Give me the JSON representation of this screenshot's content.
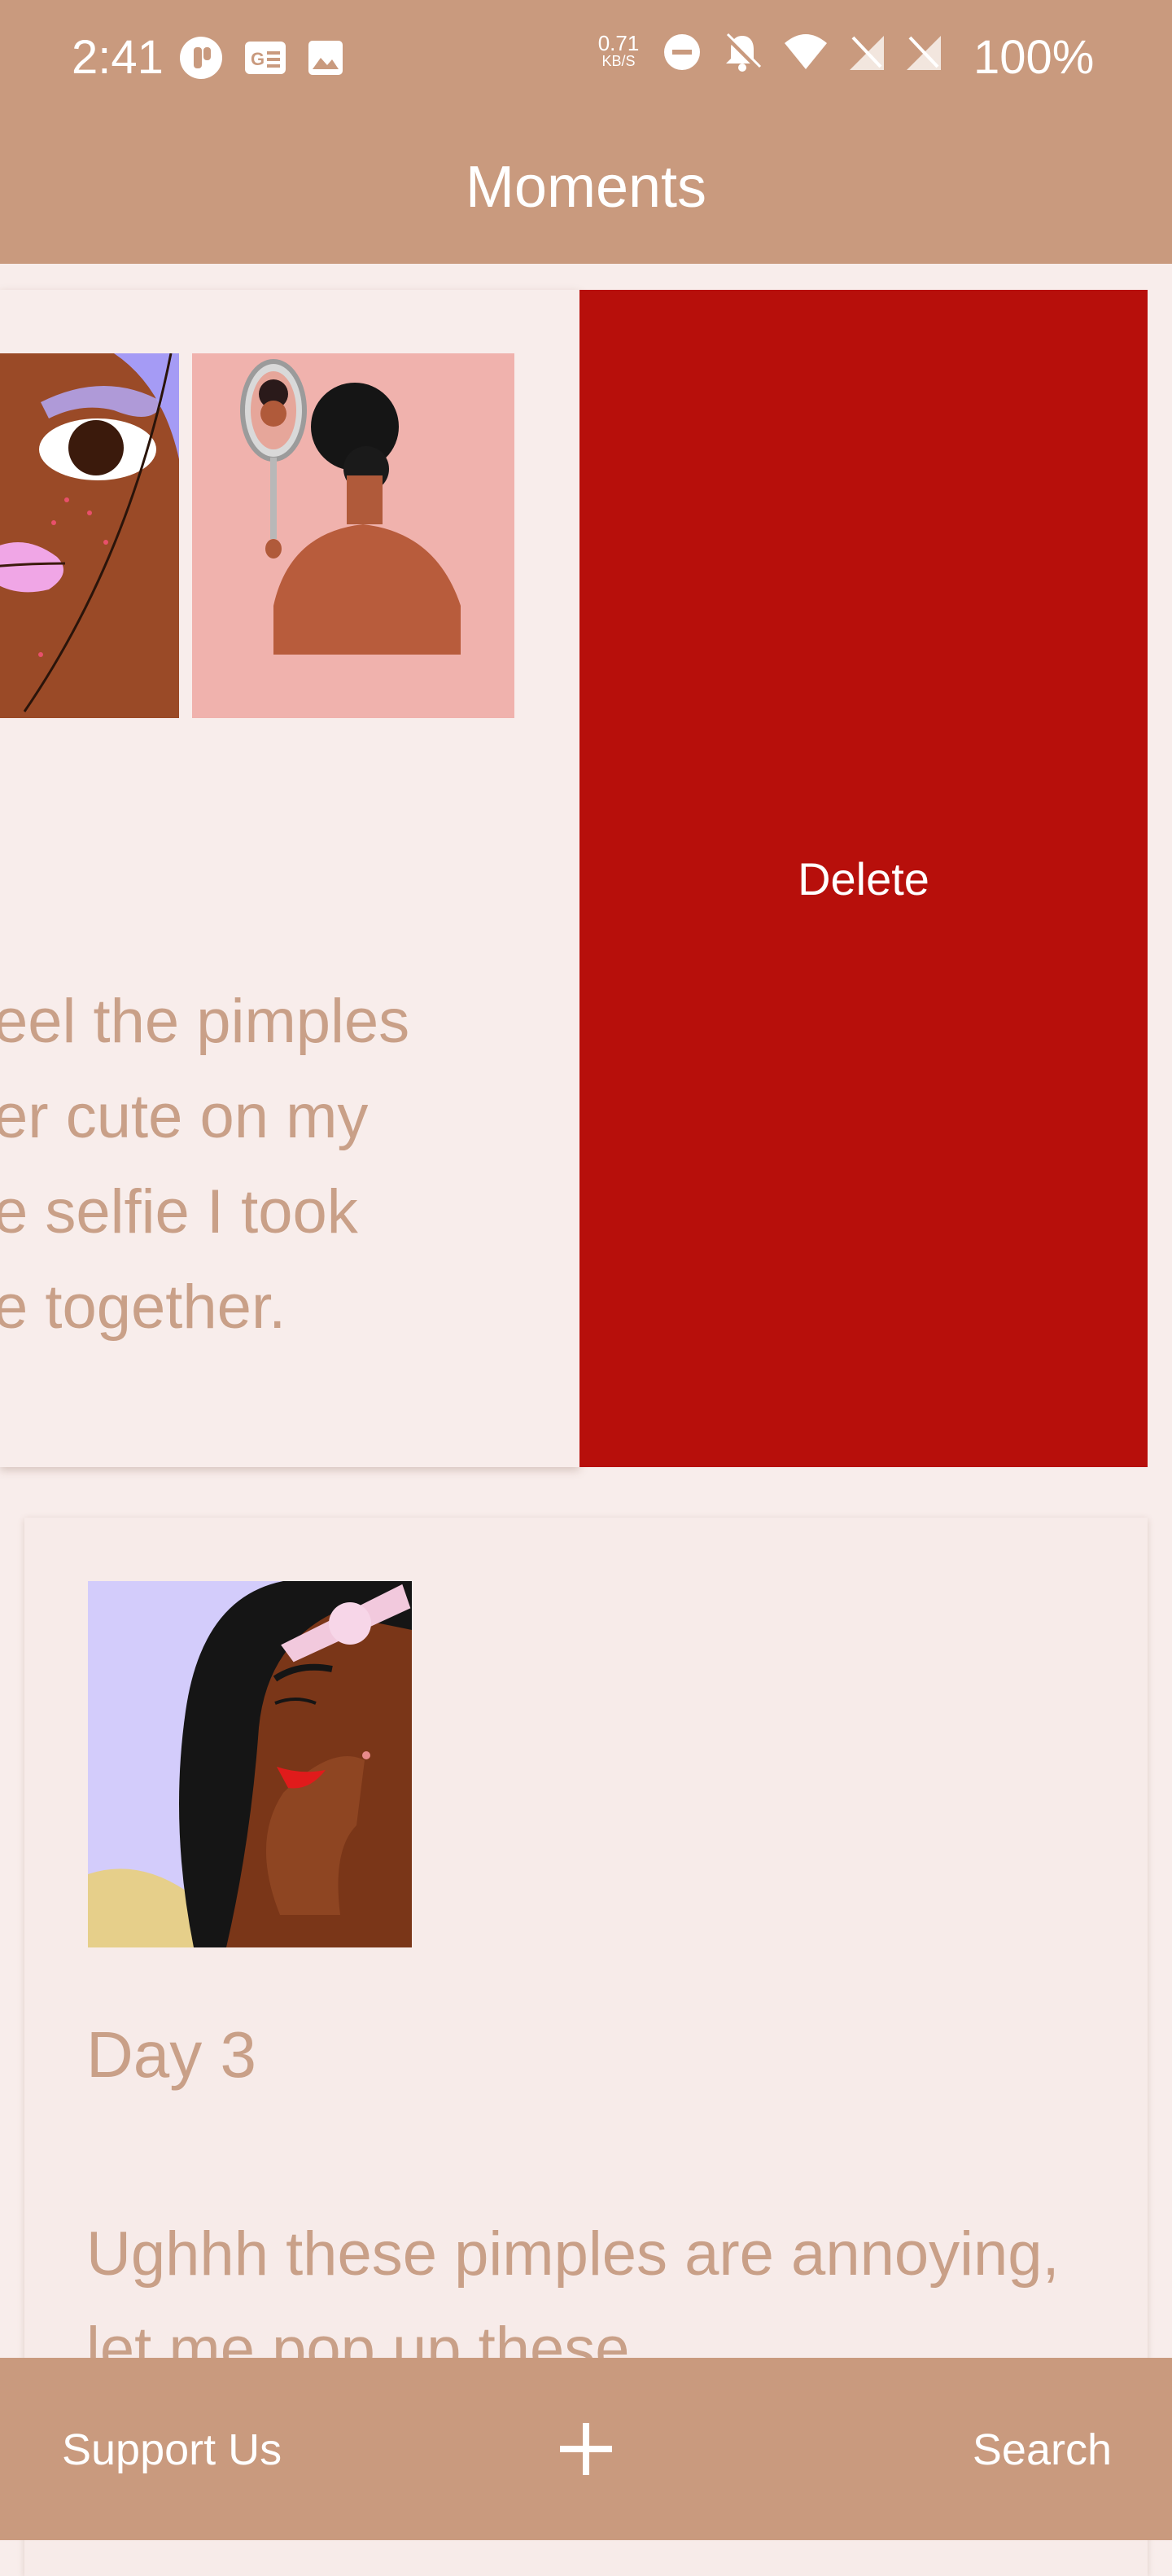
{
  "status_bar": {
    "time": "2:41",
    "network_speed_value": "0.71",
    "network_speed_unit": "KB/S",
    "battery": "100%",
    "icons": [
      "messenger-icon",
      "news-icon",
      "image-icon",
      "dnd-icon",
      "mute-icon",
      "wifi-icon",
      "no-sim-icon",
      "no-sim-icon"
    ]
  },
  "header": {
    "title": "Moments"
  },
  "moments": [
    {
      "text_lines": [
        "eel the pimples",
        "er cute on my",
        "e selfie I took",
        "e together."
      ],
      "swipe_action": "Delete"
    },
    {
      "title": "Day 3",
      "text": "Ughhh these pimples are annoying, let me pop up these"
    }
  ],
  "bottom_nav": {
    "support_label": "Support Us",
    "add_icon": "plus-icon",
    "search_label": "Search"
  },
  "colors": {
    "brand": "#c99a7e",
    "background": "#f8edeb",
    "delete": "#b70f0b",
    "text": "#c9a088"
  }
}
